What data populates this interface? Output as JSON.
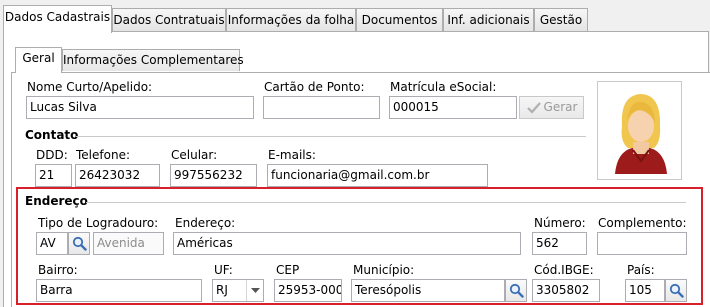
{
  "top_tabs": [
    {
      "label": "Dados Cadastrais",
      "active": true
    },
    {
      "label": "Dados Contratuais",
      "active": false
    },
    {
      "label": "Informações da folha",
      "active": false
    },
    {
      "label": "Documentos",
      "active": false
    },
    {
      "label": "Inf. adicionais",
      "active": false
    },
    {
      "label": "Gestão",
      "active": false
    }
  ],
  "inner_tabs": [
    {
      "label": "Geral",
      "active": true
    },
    {
      "label": "Informações Complementares",
      "active": false
    }
  ],
  "ident": {
    "nome_label": "Nome Curto/Apelido:",
    "nome_value": "Lucas Silva",
    "cartao_label": "Cartão de Ponto:",
    "cartao_value": "",
    "matricula_label": "Matrícula eSocial:",
    "matricula_value": "000015",
    "gerar_label": "Gerar"
  },
  "contato": {
    "title": "Contato",
    "ddd_label": "DDD:",
    "ddd_value": "21",
    "telefone_label": "Telefone:",
    "telefone_value": "26423032",
    "celular_label": "Celular:",
    "celular_value": "997556232",
    "emails_label": "E-mails:",
    "emails_value": "funcionaria@gmail.com.br"
  },
  "endereco": {
    "title": "Endereço",
    "tipo_label": "Tipo de Logradouro:",
    "tipo_code": "AV",
    "tipo_desc": "Avenida",
    "endereco_label": "Endereço:",
    "endereco_value": "Américas",
    "numero_label": "Número:",
    "numero_value": "562",
    "complemento_label": "Complemento:",
    "complemento_value": "",
    "bairro_label": "Bairro:",
    "bairro_value": "Barra",
    "uf_label": "UF:",
    "uf_value": "RJ",
    "cep_label": "CEP",
    "cep_value": "25953-000",
    "municipio_label": "Município:",
    "municipio_value": "Teresópolis",
    "codibge_label": "Cód.IBGE:",
    "codibge_value": "3305802",
    "pais_label": "País:",
    "pais_value": "105"
  },
  "colors": {
    "highlight_border": "#d8202c",
    "search_icon": "#3b6fb5"
  },
  "icons": [
    "search-icon",
    "check-icon",
    "avatar-photo",
    "chevron-down-icon"
  ]
}
